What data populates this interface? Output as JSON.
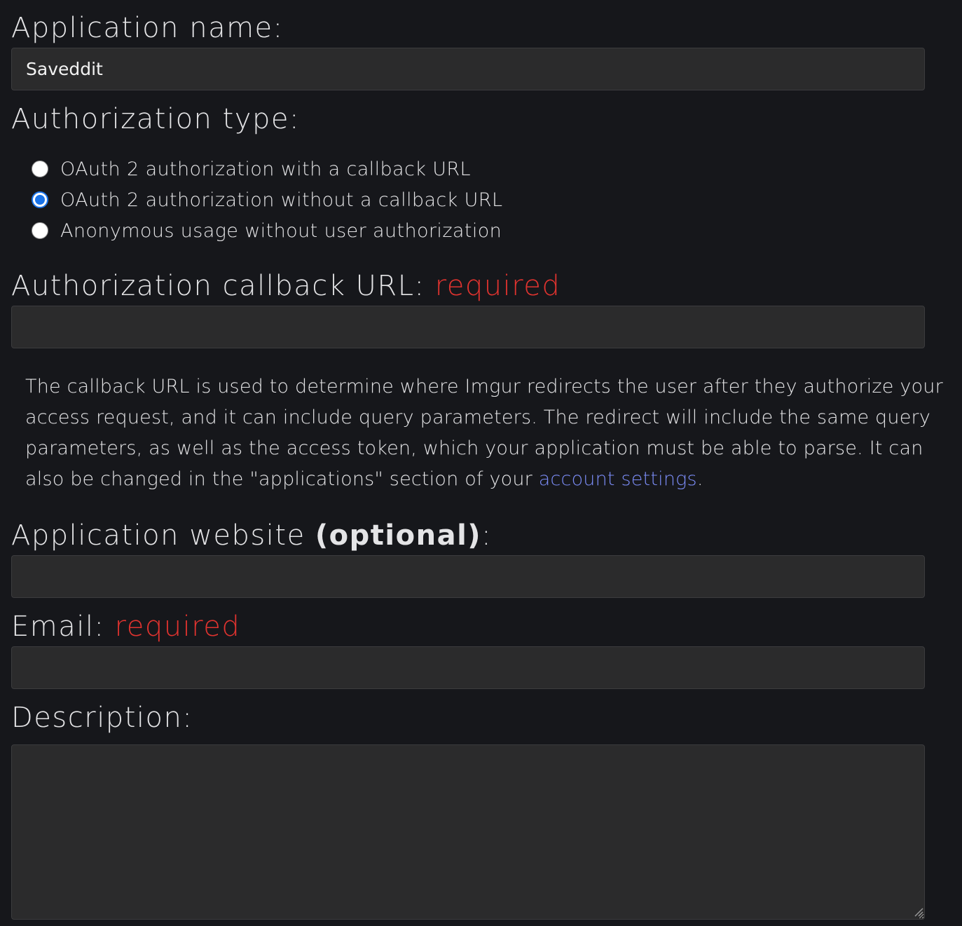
{
  "app_name": {
    "label": "Application name:",
    "value": "Saveddit"
  },
  "auth_type": {
    "label": "Authorization type:",
    "options": [
      {
        "label": "OAuth 2 authorization with a callback URL",
        "checked": false
      },
      {
        "label": "OAuth 2 authorization without a callback URL",
        "checked": true
      },
      {
        "label": "Anonymous usage without user authorization",
        "checked": false
      }
    ]
  },
  "callback_url": {
    "label": "Authorization callback URL: ",
    "required_tag": "required",
    "value": "",
    "help_text": "The callback URL is used to determine where Imgur redirects the user after they authorize your access request, and it can include query parameters. The redirect will include the same query parameters, as well as the access token, which your application must be able to parse. It can also be changed in the \"applications\" section of your ",
    "help_link": "account settings",
    "help_end": "."
  },
  "website": {
    "label": "Application website ",
    "optional_tag": "(optional)",
    "label_end": ":",
    "value": ""
  },
  "email": {
    "label": "Email: ",
    "required_tag": "required",
    "value": ""
  },
  "description": {
    "label": "Description:",
    "value": ""
  },
  "colors": {
    "background": "#16171b",
    "field": "#2b2b2c",
    "required": "#e0332f",
    "link": "#7b8cf6",
    "radio_checked": "#1a73e8"
  }
}
